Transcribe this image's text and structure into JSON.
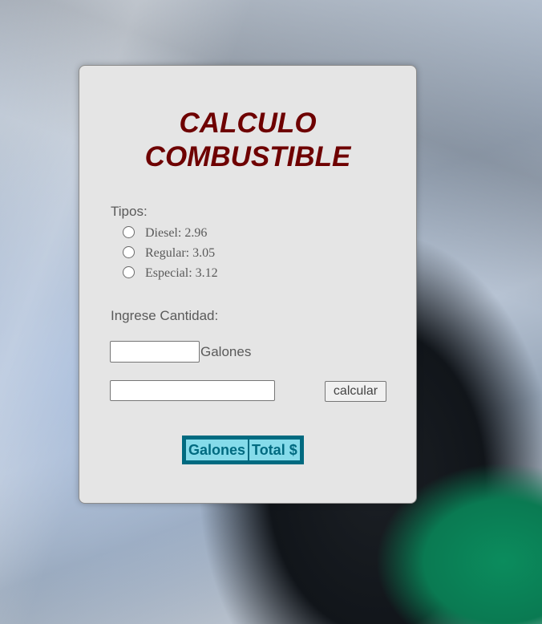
{
  "title": {
    "line1": "CALCULO",
    "line2": "COMBUSTIBLE"
  },
  "fuel_types": {
    "label": "Tipos:",
    "options": [
      {
        "label": "Diesel: 2.96",
        "selected": false
      },
      {
        "label": "Regular: 3.05",
        "selected": false
      },
      {
        "label": "Especial: 3.12",
        "selected": false
      }
    ]
  },
  "quantity": {
    "label": "Ingrese Cantidad:",
    "input_value": "",
    "unit": "Galones"
  },
  "result": {
    "value": ""
  },
  "calculate_button": {
    "label": "calcular"
  },
  "results_table": {
    "headers": [
      "Galones",
      "Total $"
    ]
  },
  "colors": {
    "title": "#6e0000",
    "table_border": "#006a80",
    "table_header_bg": "#85dbea",
    "card_bg": "#e5e5e5"
  }
}
